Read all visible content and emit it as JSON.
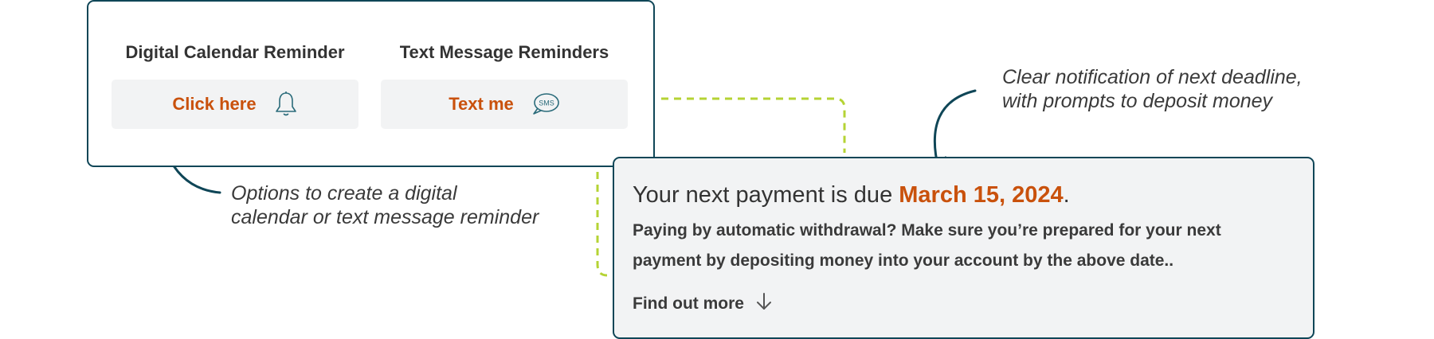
{
  "reminders": {
    "calendar": {
      "title": "Digital Calendar Reminder",
      "button_label": "Click here",
      "icon": "bell-icon"
    },
    "text": {
      "title": "Text Message Reminders",
      "button_label": "Text me",
      "icon": "sms-bubble-icon",
      "icon_text": "SMS"
    }
  },
  "payment": {
    "heading_prefix": "Your next payment is due ",
    "due_date": "March 15, 2024",
    "heading_suffix": ".",
    "body_line1": "Paying by automatic withdrawal? Make sure you’re prepared for your next",
    "body_line2": "payment by depositing money into your account by the above date..",
    "find_more_label": "Find out more",
    "find_more_icon": "arrow-down-icon"
  },
  "annotations": {
    "reminder_note_line1": "Options to create a digital",
    "reminder_note_line2": "calendar or text message reminder",
    "deadline_note_line1": "Clear notification of next deadline,",
    "deadline_note_line2": "with prompts to deposit money"
  },
  "colors": {
    "accent_orange": "#c9510c",
    "border_teal": "#0f4657",
    "connector_green": "#b5d334",
    "card_gray": "#f2f3f4"
  }
}
